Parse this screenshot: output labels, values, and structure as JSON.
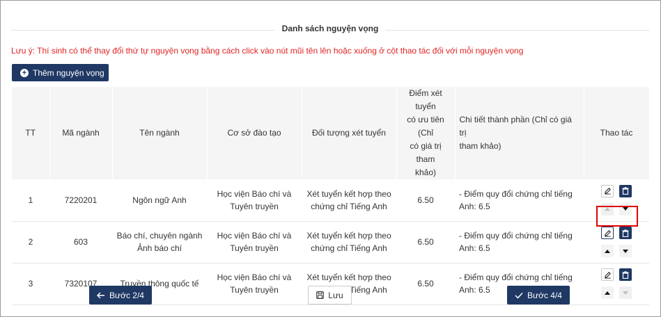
{
  "title": "Danh sách nguyện vọng",
  "note": "Lưu ý: Thí sinh có thể thay đổi thứ tự nguyện vọng bằng cách click vào nút mũi tên lên hoặc xuống ở cột thao tác đối với mỗi nguyện vọng",
  "add_button": "Thêm nguyện vọng",
  "columns": {
    "tt": "TT",
    "ma_nganh": "Mã ngành",
    "ten_nganh": "Tên ngành",
    "co_so": "Cơ sở đào tạo",
    "doi_tuong": "Đối tượng xét tuyển",
    "diem_1": "Điểm xét tuyển",
    "diem_2": "có ưu tiên (Chỉ",
    "diem_3": "có giá trị tham",
    "diem_4": "khảo)",
    "chi_tiet_1": "Chi tiết thành phần (Chỉ có giá trị",
    "chi_tiet_2": "tham khảo)",
    "thao_tac": "Thao tác"
  },
  "rows": [
    {
      "tt": "1",
      "ma_nganh": "7220201",
      "ten_nganh_1": "Ngôn ngữ Anh",
      "ten_nganh_2": "",
      "co_so_1": "Học viện Báo chí và",
      "co_so_2": "Tuyên truyền",
      "doi_tuong_1": "Xét tuyển kết hợp theo",
      "doi_tuong_2": "chứng chỉ Tiếng Anh",
      "diem": "6.50",
      "chi_tiet_1": "- Điểm quy đổi chứng chỉ tiếng",
      "chi_tiet_2": "Anh: 6.5"
    },
    {
      "tt": "2",
      "ma_nganh": "603",
      "ten_nganh_1": "Báo chí, chuyên ngành",
      "ten_nganh_2": "Ảnh báo chí",
      "co_so_1": "Học viện Báo chí và",
      "co_so_2": "Tuyên truyền",
      "doi_tuong_1": "Xét tuyển kết hợp theo",
      "doi_tuong_2": "chứng chỉ Tiếng Anh",
      "diem": "6.50",
      "chi_tiet_1": "- Điểm quy đổi chứng chỉ tiếng",
      "chi_tiet_2": "Anh: 6.5"
    },
    {
      "tt": "3",
      "ma_nganh": "7320107",
      "ten_nganh_1": "Truyền thông quốc tế",
      "ten_nganh_2": "",
      "co_so_1": "Học viện Báo chí và",
      "co_so_2": "Tuyên truyền",
      "doi_tuong_1": "Xét tuyển kết hợp theo",
      "doi_tuong_2": "chứng chỉ Tiếng Anh",
      "diem": "6.50",
      "chi_tiet_1": "- Điểm quy đổi chứng chỉ tiếng",
      "chi_tiet_2": "Anh: 6.5"
    }
  ],
  "footer": {
    "prev": "Bước 2/4",
    "save": "Lưu",
    "next": "Bước 4/4"
  },
  "colors": {
    "primary": "#1f3864",
    "note": "#e02424",
    "highlight": "#e00000"
  },
  "icons": {
    "add": "plus-circle-icon",
    "edit": "pencil-icon",
    "delete": "trash-icon",
    "up": "arrow-up-icon",
    "down": "arrow-down-icon",
    "prev": "arrow-left-icon",
    "save": "floppy-disk-icon",
    "next": "checkmark-icon"
  }
}
